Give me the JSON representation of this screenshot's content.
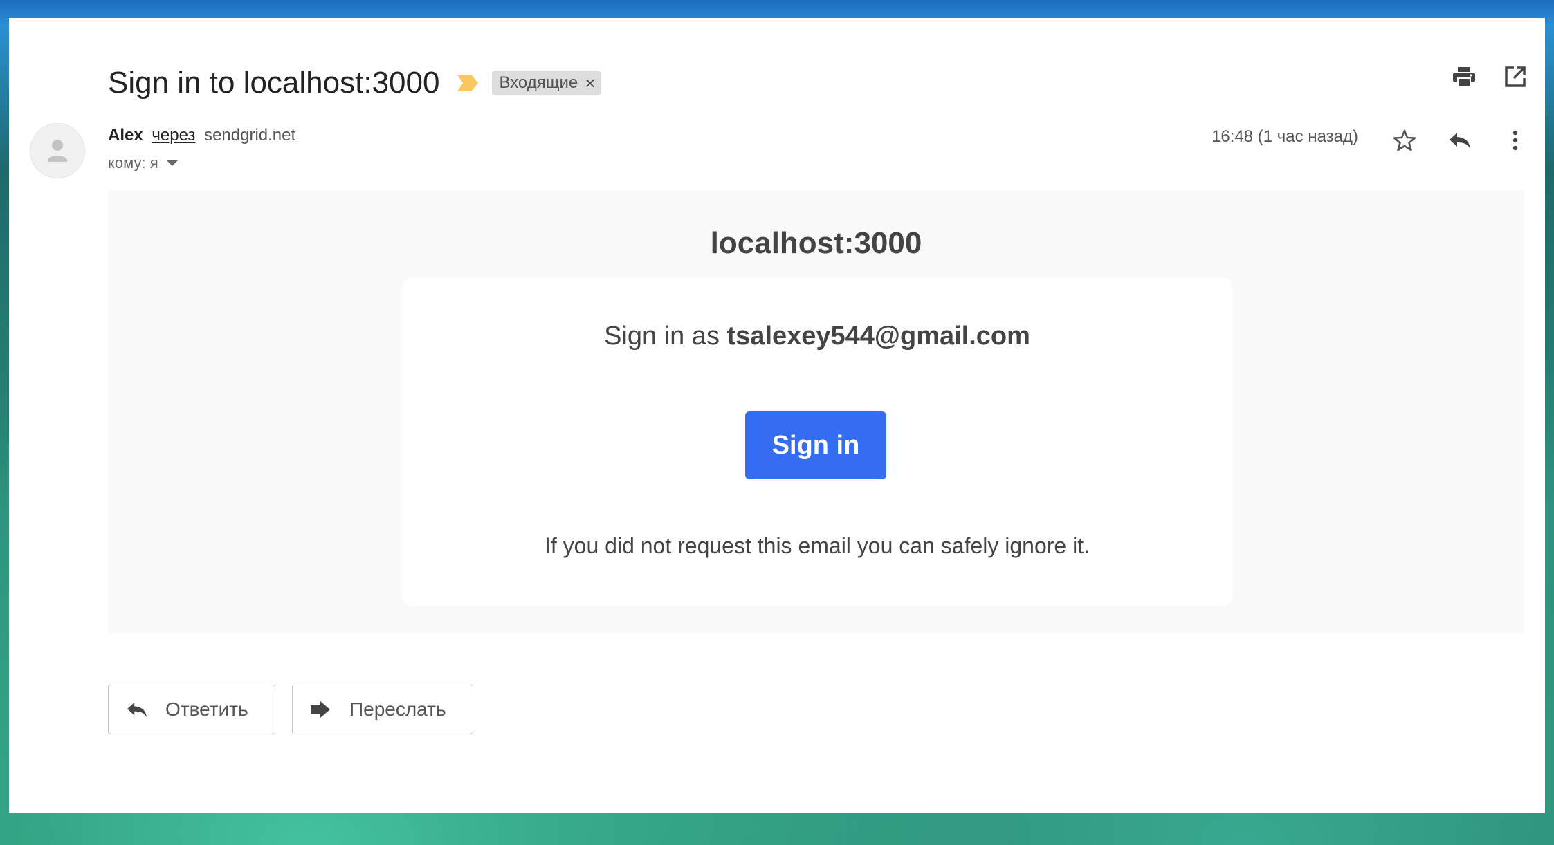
{
  "email": {
    "subject": "Sign in to localhost:3000",
    "label": "Входящие",
    "label_close": "×",
    "sender_name": "Alex",
    "via": "через",
    "via_domain": "sendgrid.net",
    "recipient": "кому: я",
    "timestamp": "16:48 (1 час назад)"
  },
  "body": {
    "site_name": "localhost:3000",
    "signin_prefix": "Sign in as ",
    "signin_email": "tsalexey544@gmail.com",
    "signin_button": "Sign in",
    "ignore_note": "If you did not request this email you can safely ignore it."
  },
  "actions": {
    "reply": "Ответить",
    "forward": "Переслать"
  },
  "icons": {
    "print": "print-icon",
    "open_new_window": "open-in-new-window-icon",
    "star": "star-icon",
    "reply": "reply-icon",
    "more": "more-vertical-icon",
    "forward": "forward-icon",
    "avatar": "person-icon",
    "importance": "importance-marker-icon"
  },
  "colors": {
    "accent_button": "#346df1",
    "importance_marker": "#f6c85f",
    "label_chip_bg": "#dddddd"
  }
}
